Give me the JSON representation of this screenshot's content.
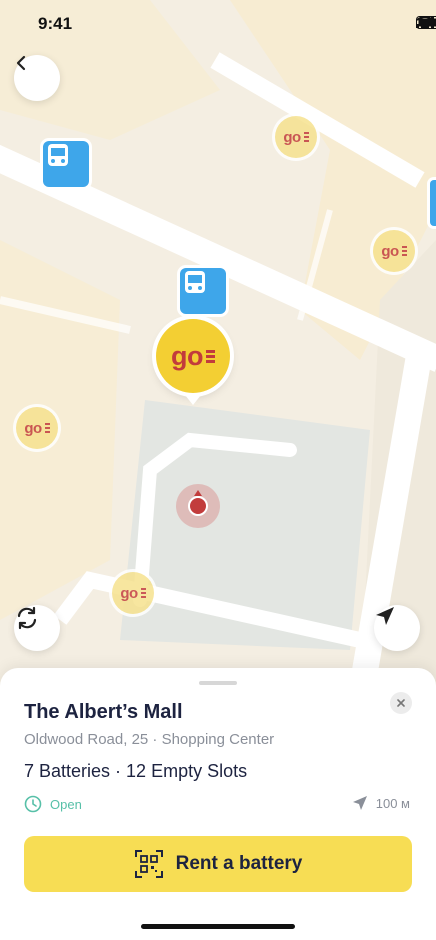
{
  "status_bar": {
    "time": "9:41"
  },
  "map": {
    "pin_logo": "go",
    "colors": {
      "pin_big": "#f3cf33",
      "pin_small": "#f6e28f",
      "logo": "#c23c3c",
      "bus": "#3ea6ea"
    }
  },
  "sheet": {
    "title": "The Albert’s Mall",
    "address": "Oldwood Road, 25 · Shopping Center",
    "capacity": "7 Batteries · 12 Empty Slots",
    "status": "Open",
    "distance": "100 м",
    "cta_label": "Rent a battery"
  },
  "icons": [
    "back-icon",
    "refresh-icon",
    "locate-icon",
    "bus-icon",
    "close-icon",
    "clock-icon",
    "navigation-arrow-icon",
    "qr-scan-icon"
  ],
  "colors": {
    "accent": "#f7dd54",
    "text_dark": "#1d2340",
    "open_green": "#57c0a8"
  }
}
